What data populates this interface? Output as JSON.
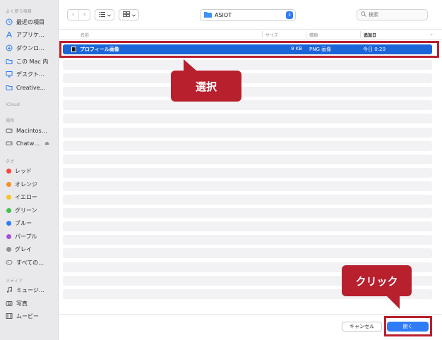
{
  "sidebar": {
    "sections": {
      "favorites": "よく使う項目",
      "icloud": "iCloud",
      "locations": "場所",
      "tags": "タグ",
      "media": "メディア"
    },
    "favorites": [
      {
        "label": "最近の項目",
        "icon": "clock-icon"
      },
      {
        "label": "アプリケ…",
        "icon": "applications-icon"
      },
      {
        "label": "ダウンロ…",
        "icon": "download-icon"
      },
      {
        "label": "この Mac 内",
        "icon": "folder-icon"
      },
      {
        "label": "デスクト…",
        "icon": "desktop-icon"
      },
      {
        "label": "Creative…",
        "icon": "folder-icon"
      }
    ],
    "locations": [
      {
        "label": "Macintos…",
        "icon": "disk-icon"
      },
      {
        "label": "Chatw…",
        "icon": "disk-icon",
        "eject": "⏏"
      }
    ],
    "tags": [
      {
        "label": "レッド",
        "color": "#f2473f"
      },
      {
        "label": "オレンジ",
        "color": "#f6911e"
      },
      {
        "label": "イエロー",
        "color": "#f5c426"
      },
      {
        "label": "グリーン",
        "color": "#3fc14a"
      },
      {
        "label": "ブルー",
        "color": "#2f7cf6"
      },
      {
        "label": "パープル",
        "color": "#a550d7"
      },
      {
        "label": "グレイ",
        "color": "#8e8e93"
      },
      {
        "label": "すべての…",
        "color": "outline"
      }
    ],
    "media": [
      {
        "label": "ミュージ…",
        "icon": "music-icon"
      },
      {
        "label": "写真",
        "icon": "photo-icon"
      },
      {
        "label": "ムービー",
        "icon": "movie-icon"
      }
    ]
  },
  "toolbar": {
    "back": "‹",
    "forward": "›",
    "location": "ASIOT",
    "search_placeholder": "検索"
  },
  "columns": {
    "name": "名前",
    "size": "サイズ",
    "kind": "種類",
    "date_added": "追加日"
  },
  "files": [
    {
      "name": "プロフィール画像",
      "size": "9 KB",
      "kind": "PNG 画像",
      "date_added": "今日 0:20",
      "selected": true
    }
  ],
  "buttons": {
    "cancel": "キャンセル",
    "open": "開く"
  },
  "annotations": {
    "select_label": "選択",
    "click_label": "クリック",
    "color": "#b8202e"
  },
  "colors": {
    "accent": "#2f7cf6",
    "selection": "#1b65d9"
  }
}
